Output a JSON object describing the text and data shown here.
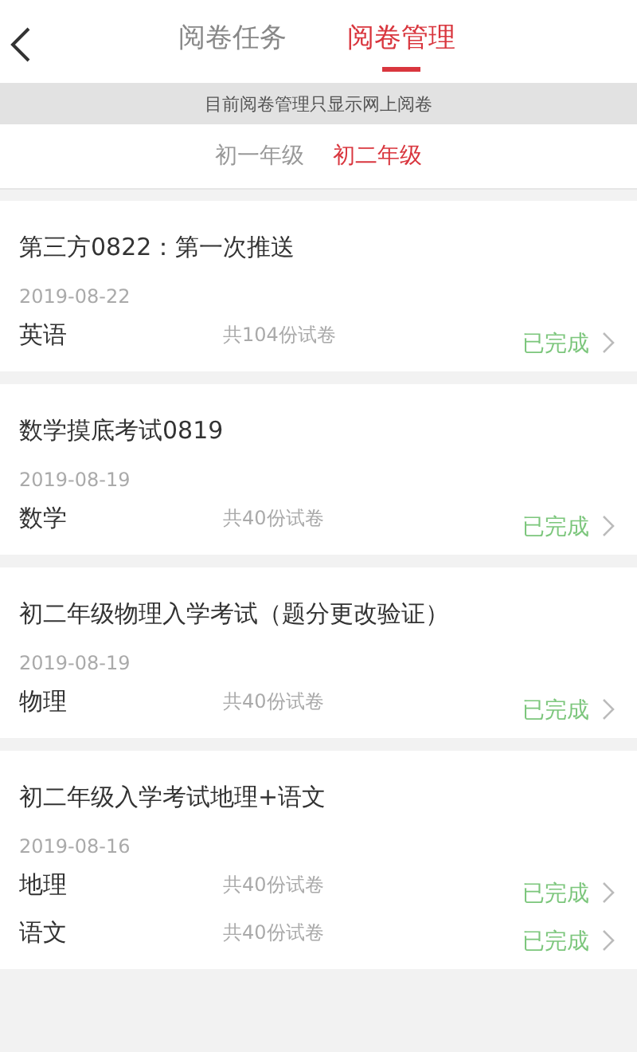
{
  "header": {
    "tabs": [
      {
        "label": "阅卷任务",
        "selected": false
      },
      {
        "label": "阅卷管理",
        "selected": true
      }
    ]
  },
  "notice": "目前阅卷管理只显示网上阅卷",
  "grades": [
    {
      "label": "初一年级",
      "selected": false
    },
    {
      "label": "初二年级",
      "selected": true
    }
  ],
  "exams": [
    {
      "title": "第三方0822：第一次推送",
      "date": "2019-08-22",
      "subjects": [
        {
          "name": "英语",
          "count": "共104份试卷",
          "status": "已完成"
        }
      ]
    },
    {
      "title": "数学摸底考试0819",
      "date": "2019-08-19",
      "subjects": [
        {
          "name": "数学",
          "count": "共40份试卷",
          "status": "已完成"
        }
      ]
    },
    {
      "title": "初二年级物理入学考试（题分更改验证）",
      "date": "2019-08-19",
      "subjects": [
        {
          "name": "物理",
          "count": "共40份试卷",
          "status": "已完成"
        }
      ]
    },
    {
      "title": "初二年级入学考试地理+语文",
      "date": "2019-08-16",
      "subjects": [
        {
          "name": "地理",
          "count": "共40份试卷",
          "status": "已完成"
        },
        {
          "name": "语文",
          "count": "共40份试卷",
          "status": "已完成"
        }
      ]
    }
  ]
}
